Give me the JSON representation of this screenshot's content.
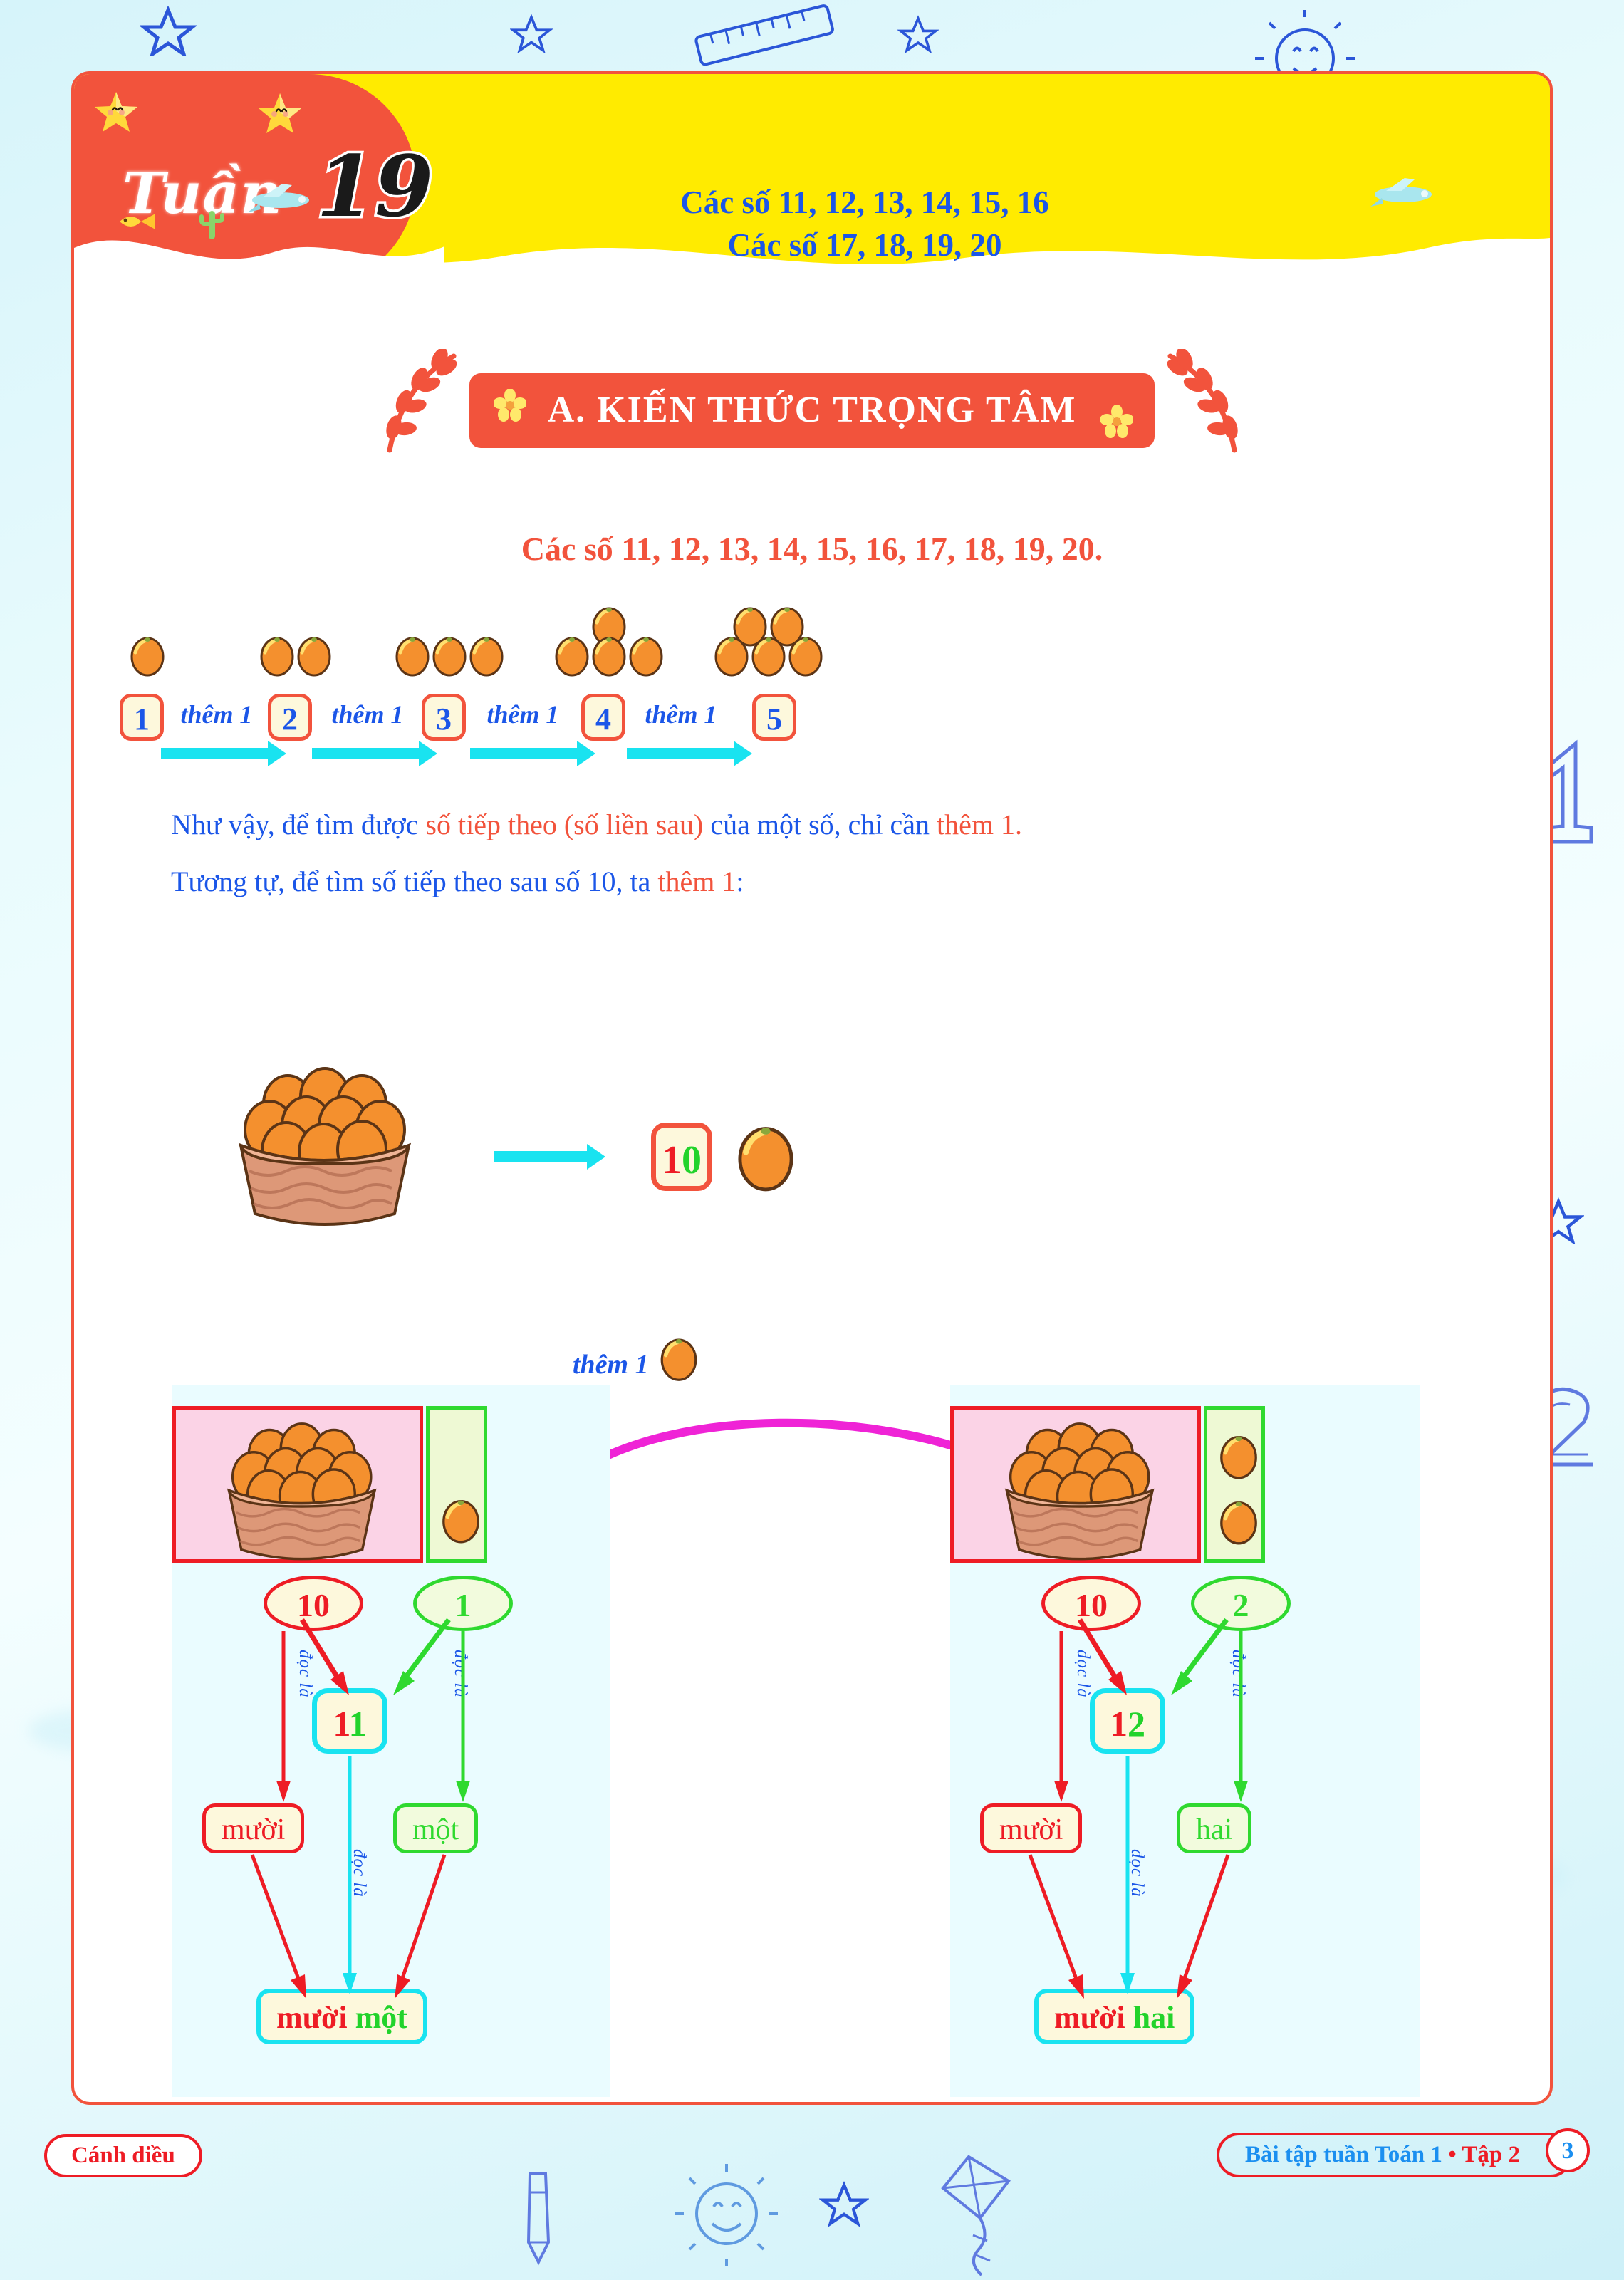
{
  "header": {
    "week_label": "Tuần",
    "week_number": "19",
    "title_line1": "Các số 11, 12, 13, 14, 15, 16",
    "title_line2": "Các số 17, 18, 19, 20"
  },
  "section": {
    "ribbon_title": "A. KIẾN THỨC TRỌNG TÂM",
    "subtitle": "Các số 11, 12, 13, 14, 15, 16, 17, 18, 19, 20."
  },
  "sequence": {
    "steps": [
      {
        "number": "1",
        "fruit_count": 1
      },
      {
        "number": "2",
        "fruit_count": 2
      },
      {
        "number": "3",
        "fruit_count": 3
      },
      {
        "number": "4",
        "fruit_count": 4
      },
      {
        "number": "5",
        "fruit_count": 5
      }
    ],
    "arrow_label": "thêm 1"
  },
  "paragraphs": {
    "p1_a": "Như vậy, để tìm được ",
    "p1_b": "số tiếp theo (số liền sau)",
    "p1_c": " của một số, chỉ cần ",
    "p1_d": "thêm 1",
    "p1_e": ".",
    "p2_a": "Tương tự, để tìm số tiếp theo sau số 10, ta ",
    "p2_b": "thêm 1",
    "p2_c": ":"
  },
  "basket_row": {
    "ten_first": "1",
    "ten_second": "0",
    "basket_count": 10,
    "loose_fruit": 1
  },
  "bridge": {
    "label": "thêm 1"
  },
  "panels": [
    {
      "id": "eleven",
      "tens_value": "10",
      "ones_value": "1",
      "result_first": "1",
      "result_second": "1",
      "tens_word": "mười",
      "ones_word": "một",
      "result_word_a": "mười",
      "result_word_b": "một",
      "read_label": "đọc là",
      "basket_count": 10,
      "loose_count": 1
    },
    {
      "id": "twelve",
      "tens_value": "10",
      "ones_value": "2",
      "result_first": "1",
      "result_second": "2",
      "tens_word": "mười",
      "ones_word": "hai",
      "result_word_a": "mười",
      "result_word_b": "hai",
      "read_label": "đọc là",
      "basket_count": 10,
      "loose_count": 2
    }
  ],
  "footer": {
    "brand": "Cánh diều",
    "book_title": "Bài tập tuần Toán 1",
    "separator": "•",
    "volume": "Tập 2",
    "page_number": "3"
  },
  "colors": {
    "red": "#f2533c",
    "crimson": "#ee1c25",
    "blue": "#1b56e8",
    "green": "#2fd92f",
    "cyan": "#19e3f0",
    "yellow": "#ffeb00",
    "cream": "#fdf8dc",
    "magenta": "#ef23d6",
    "sky": "#d6f4fa"
  },
  "decor": {
    "icons": [
      "star-doodle",
      "ruler-doodle",
      "sun-doodle",
      "kite-doodle",
      "pencil-doodle",
      "digit-one-doodle",
      "digit-two-doodle",
      "airplane-sticker",
      "fish-sticker",
      "cactus-sticker",
      "flower-sticker"
    ]
  }
}
